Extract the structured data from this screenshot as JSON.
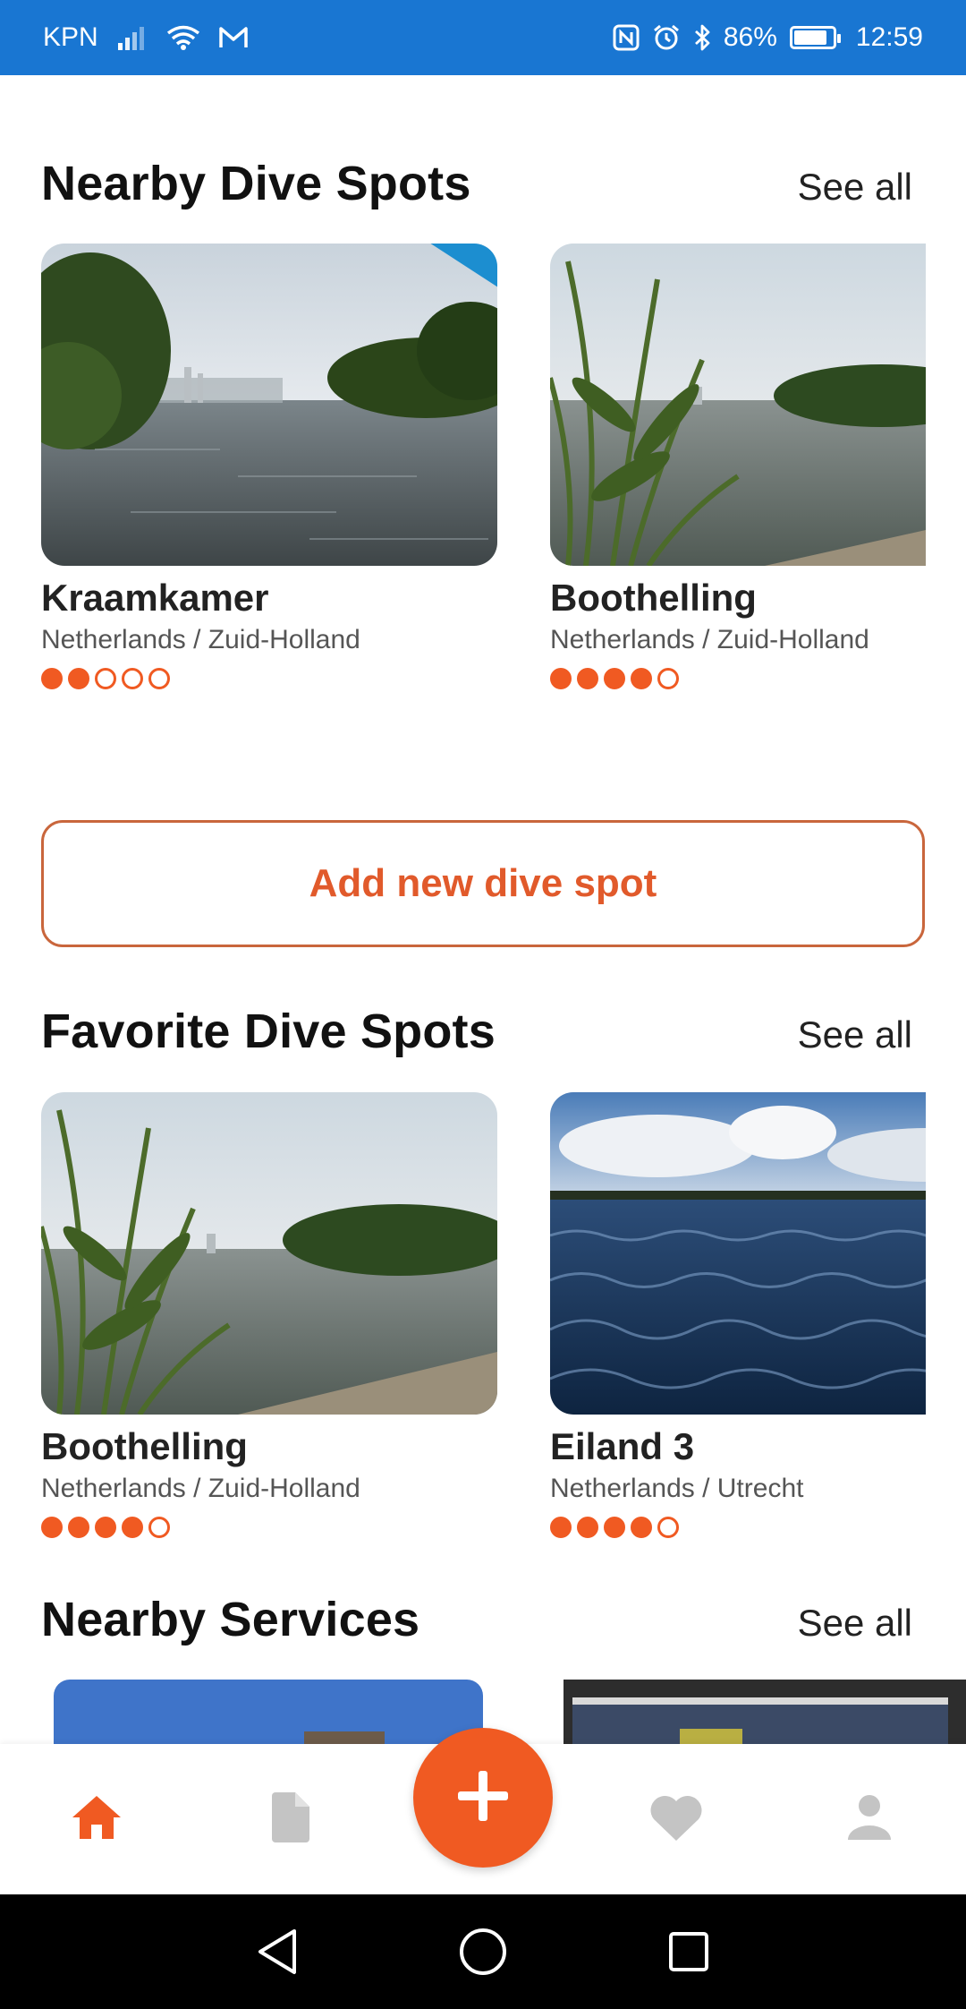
{
  "status_bar": {
    "carrier": "KPN",
    "battery": "86%",
    "battery_level": 0.86,
    "time": "12:59",
    "icons": [
      "signal-icon",
      "wifi-icon",
      "gmail-icon",
      "nfc-icon",
      "alarm-icon",
      "bluetooth-icon",
      "battery-icon"
    ]
  },
  "nearby_dive_spots": {
    "title": "Nearby Dive Spots",
    "see_all": "See all",
    "cards": [
      {
        "name": "Kraamkamer",
        "location": "Netherlands / Zuid-Holland",
        "rating": 2,
        "rating_max": 5,
        "locked": true,
        "lock_icon": "lock-icon"
      },
      {
        "name": "Boothelling",
        "location": "Netherlands / Zuid-Holland",
        "rating": 4,
        "rating_max": 5,
        "locked": false
      }
    ]
  },
  "add_button": {
    "label": "Add new dive spot"
  },
  "favorite_dive_spots": {
    "title": "Favorite Dive Spots",
    "see_all": "See all",
    "cards": [
      {
        "name": "Boothelling",
        "location": "Netherlands / Zuid-Holland",
        "rating": 4,
        "rating_max": 5
      },
      {
        "name": "Eiland 3",
        "location": "Netherlands / Utrecht",
        "rating": 4,
        "rating_max": 5
      }
    ]
  },
  "nearby_services": {
    "title": "Nearby Services",
    "see_all": "See all"
  },
  "bottom_nav": {
    "items": [
      {
        "icon": "home-icon",
        "active": true
      },
      {
        "icon": "document-icon",
        "active": false
      },
      {
        "icon": "plus-icon",
        "active": false
      },
      {
        "icon": "heart-icon",
        "active": false
      },
      {
        "icon": "person-icon",
        "active": false
      }
    ]
  },
  "system_nav": {
    "icons": [
      "back-icon",
      "home-circle-icon",
      "recents-icon"
    ]
  },
  "colors": {
    "accent": "#f05a22",
    "status_bar": "#1976d2",
    "ribbon": "#1c8ed0",
    "button_border": "#c9663c"
  }
}
